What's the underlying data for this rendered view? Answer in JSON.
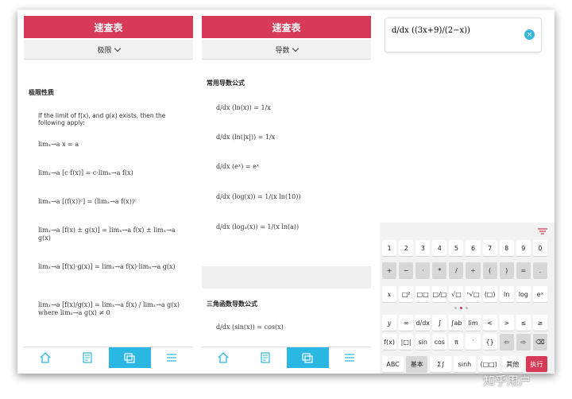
{
  "panels": [
    {
      "header": "速查表",
      "dropdown": "极限"
    },
    {
      "header": "速查表",
      "dropdown": "导数"
    }
  ],
  "limits": {
    "section": "极限性质",
    "intro": "If the limit of f(x), and g(x) exists, then the following apply:",
    "formulas": [
      "limₓ→a x = a",
      "limₓ→a [c·f(x)] = c·limₓ→a f(x)",
      "limₓ→a [(f(x))ᶜ] = (limₓ→a f(x))ᶜ",
      "limₓ→a [f(x) ± g(x)] = limₓ→a f(x) ± limₓ→a g(x)",
      "limₓ→a [f(x)·g(x)] = limₓ→a f(x)·limₓ→a g(x)",
      "limₓ→a [f(x)/g(x)] = limₓ→a f(x) / limₓ→a g(x)  where limₓ→a g(x) ≠ 0"
    ]
  },
  "derivs": {
    "section1": "常用导数公式",
    "formulas": [
      "d/dx (ln(x)) = 1/x",
      "d/dx (ln(|x|)) = 1/x",
      "d/dx (eˣ) = eˣ",
      "d/dx (log(x)) = 1/(x ln(10))",
      "d/dx (logₐ(x)) = 1/(x ln(a))"
    ],
    "section2": "三角函数导数公式",
    "trig": [
      "d/dx (sin(x)) = cos(x)"
    ]
  },
  "input": {
    "expression": "d/dx ((3x+9)/(2−x))"
  },
  "keyboard": {
    "row1": [
      "1",
      "2",
      "3",
      "4",
      "5",
      "6",
      "7",
      "8",
      "9",
      "0"
    ],
    "row2": [
      "+",
      "−",
      "·",
      "*",
      "/",
      "÷",
      "(",
      ")",
      "=",
      "."
    ],
    "row3": [
      "x",
      "□²",
      "□□",
      "□/□",
      "√□",
      "ⁿ√□",
      "(□)",
      "ln",
      "log",
      "eˣ"
    ],
    "row4": [
      "y",
      "∞",
      "d/dx",
      "∫",
      "∫ab",
      "lim",
      "<",
      ">",
      "≤",
      "≥"
    ],
    "row5": [
      "f(x)",
      "|□|",
      "sin",
      "cos",
      "π",
      "′",
      "{}",
      "⇦",
      "⇨",
      "⌫"
    ],
    "row6": [
      "ABC",
      "基本",
      "Σ∫",
      "sinh",
      "(□□)",
      "其他",
      "执行"
    ]
  },
  "watermark": "知乎用户",
  "colors": {
    "accent": "#d73a56",
    "nav_active": "#2bb7e3"
  }
}
